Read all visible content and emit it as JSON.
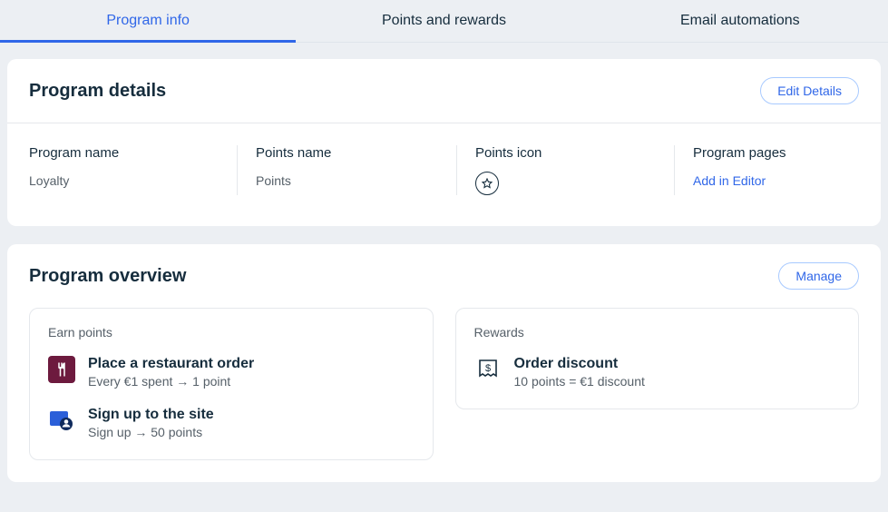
{
  "tabs": {
    "program_info": "Program info",
    "points_rewards": "Points and rewards",
    "email_automations": "Email automations"
  },
  "program_details": {
    "title": "Program details",
    "edit_button": "Edit Details",
    "program_name_label": "Program name",
    "program_name_value": "Loyalty",
    "points_name_label": "Points name",
    "points_name_value": "Points",
    "points_icon_label": "Points icon",
    "program_pages_label": "Program pages",
    "program_pages_link": "Add in Editor"
  },
  "program_overview": {
    "title": "Program overview",
    "manage_button": "Manage",
    "earn_points": {
      "title": "Earn points",
      "items": [
        {
          "title": "Place a restaurant order",
          "sub": "Every €1 spent → 1 point"
        },
        {
          "title": "Sign up to the site",
          "sub": "Sign up → 50 points"
        }
      ]
    },
    "rewards": {
      "title": "Rewards",
      "items": [
        {
          "title": "Order discount",
          "sub": "10 points = €1 discount"
        }
      ]
    }
  }
}
